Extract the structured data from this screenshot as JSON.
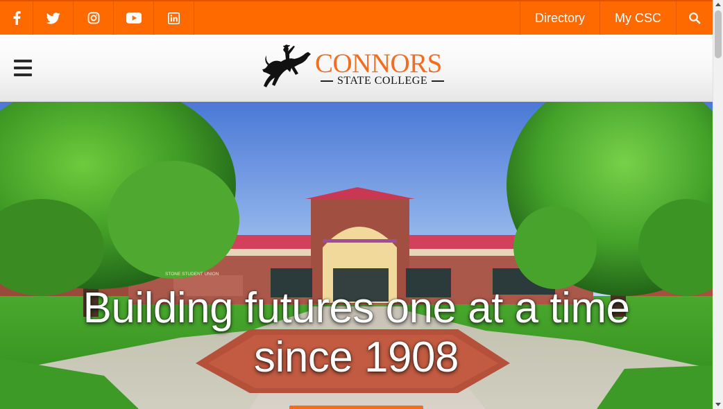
{
  "social_icons": [
    "facebook-icon",
    "twitter-icon",
    "instagram-icon",
    "youtube-icon",
    "linkedin-icon"
  ],
  "nav": {
    "directory": "Directory",
    "my_csc": "My CSC",
    "search_icon": "search-icon"
  },
  "header": {
    "menu_icon": "hamburger-menu-icon",
    "logo_name": "CONNORS",
    "logo_sub": "STATE COLLEGE"
  },
  "hero": {
    "title_line1": "Building futures one at a time",
    "title_line2": "since 1908",
    "building_sign": "STONE STUDENT UNION"
  },
  "colors": {
    "brand_orange": "#ff6a00",
    "logo_orange": "#f26d21",
    "hamburger": "#2a2a2a"
  }
}
